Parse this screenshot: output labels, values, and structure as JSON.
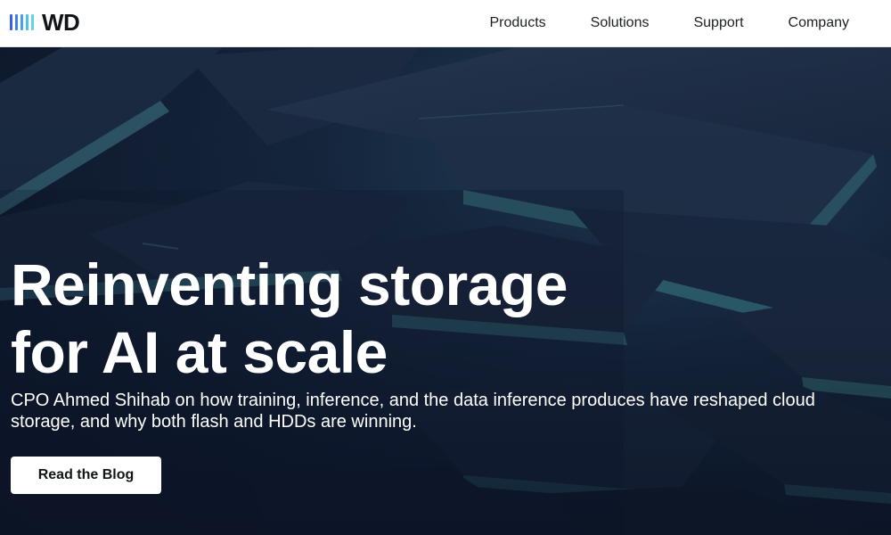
{
  "header": {
    "logo_text": "WD",
    "nav": [
      {
        "label": "Products"
      },
      {
        "label": "Solutions"
      },
      {
        "label": "Support"
      },
      {
        "label": "Company"
      }
    ]
  },
  "hero": {
    "title_line1": "Reinventing storage",
    "title_line2": "for AI at scale",
    "description": "CPO Ahmed Shihab on how training, inference, and the data inference produces have reshaped cloud storage, and why both flash and HDDs are winning.",
    "cta_label": "Read the Blog"
  },
  "colors": {
    "header_bg": "#ffffff",
    "hero_bg": "#0f1a2e",
    "hero_text": "#ffffff",
    "logo_blue": "#2f6df6",
    "logo_cyan": "#4cc7e8"
  }
}
